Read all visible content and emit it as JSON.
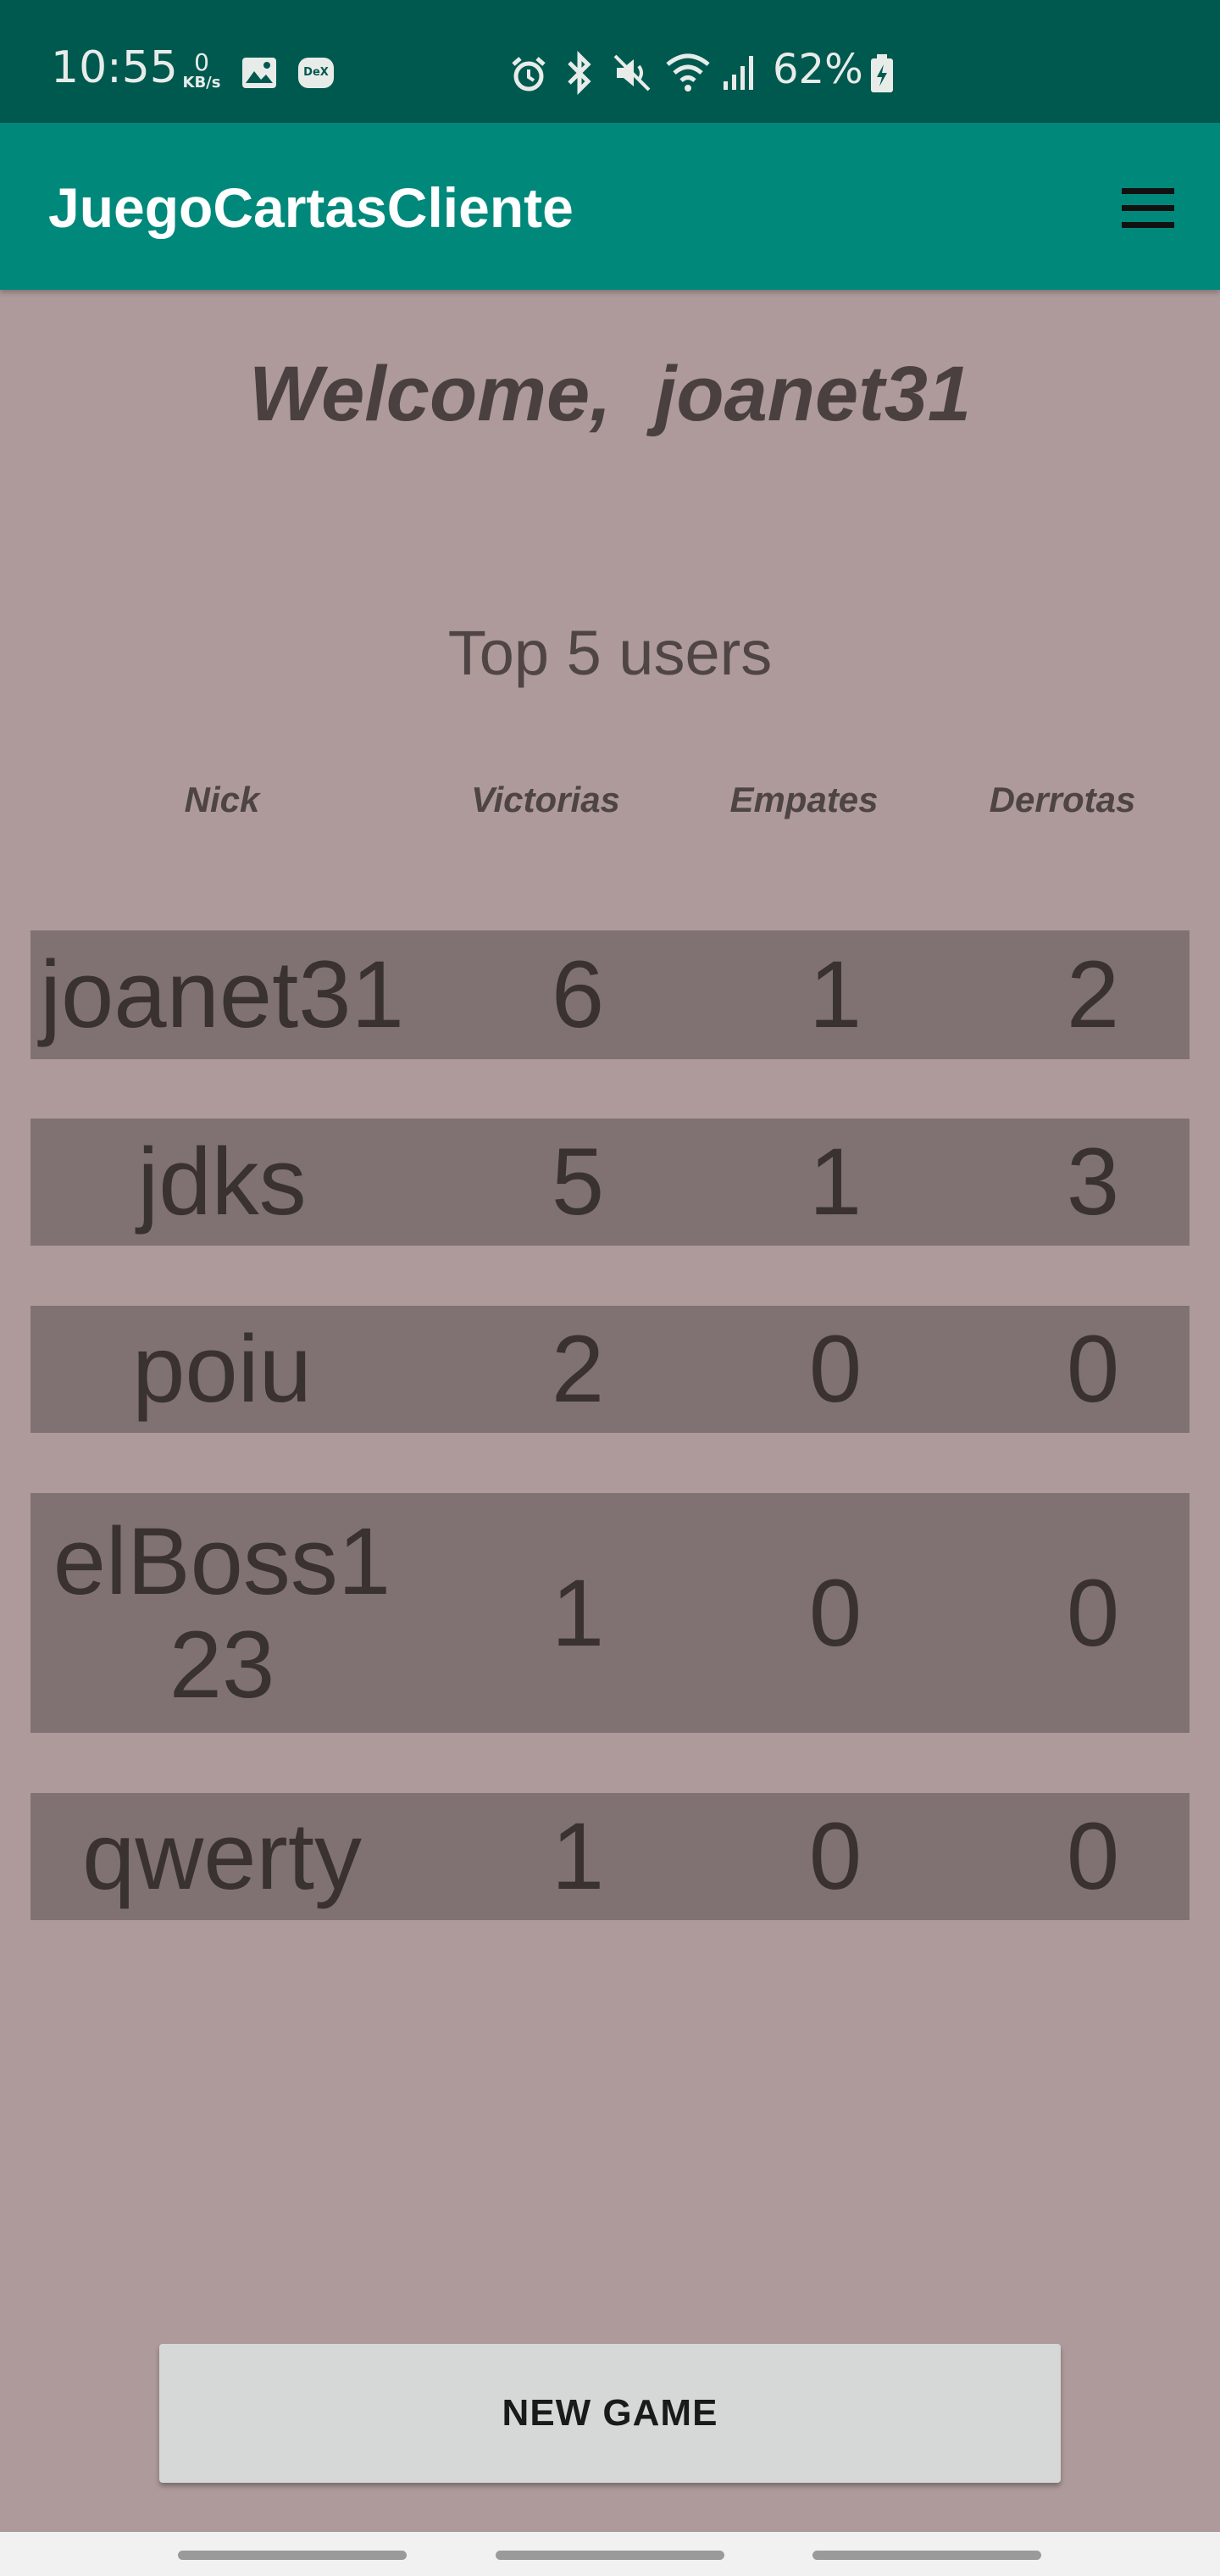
{
  "status_bar": {
    "time": "10:55",
    "net_speed_value": "0",
    "net_speed_unit": "KB/s",
    "dex_label": "DeX",
    "battery": "62%",
    "icons": [
      "gallery-icon",
      "dex-icon",
      "alarm-icon",
      "bluetooth-icon",
      "mute-icon",
      "wifi-icon",
      "signal-icon",
      "battery-charging-icon"
    ]
  },
  "app_bar": {
    "title": "JuegoCartasCliente",
    "menu_icon": "hamburger-menu-icon"
  },
  "main": {
    "welcome": "Welcome,  joanet31",
    "ranking_title": "Top 5 users",
    "columns": [
      "Nick",
      "Victorias",
      "Empates",
      "Derrotas"
    ],
    "rows": [
      {
        "nick": "joanet31",
        "victorias": "6",
        "empates": "1",
        "derrotas": "2"
      },
      {
        "nick": "jdks",
        "victorias": "5",
        "empates": "1",
        "derrotas": "3"
      },
      {
        "nick": "poiu",
        "victorias": "2",
        "empates": "0",
        "derrotas": "0"
      },
      {
        "nick": "elBoss1\n23",
        "victorias": "1",
        "empates": "0",
        "derrotas": "0"
      },
      {
        "nick": "qwerty",
        "victorias": "1",
        "empates": "0",
        "derrotas": "0"
      }
    ],
    "new_game_label": "NEW GAME"
  },
  "colors": {
    "status_bar": "#00594f",
    "app_bar": "#00897b",
    "background": "#ae9a9a",
    "row_background": "#807272"
  }
}
